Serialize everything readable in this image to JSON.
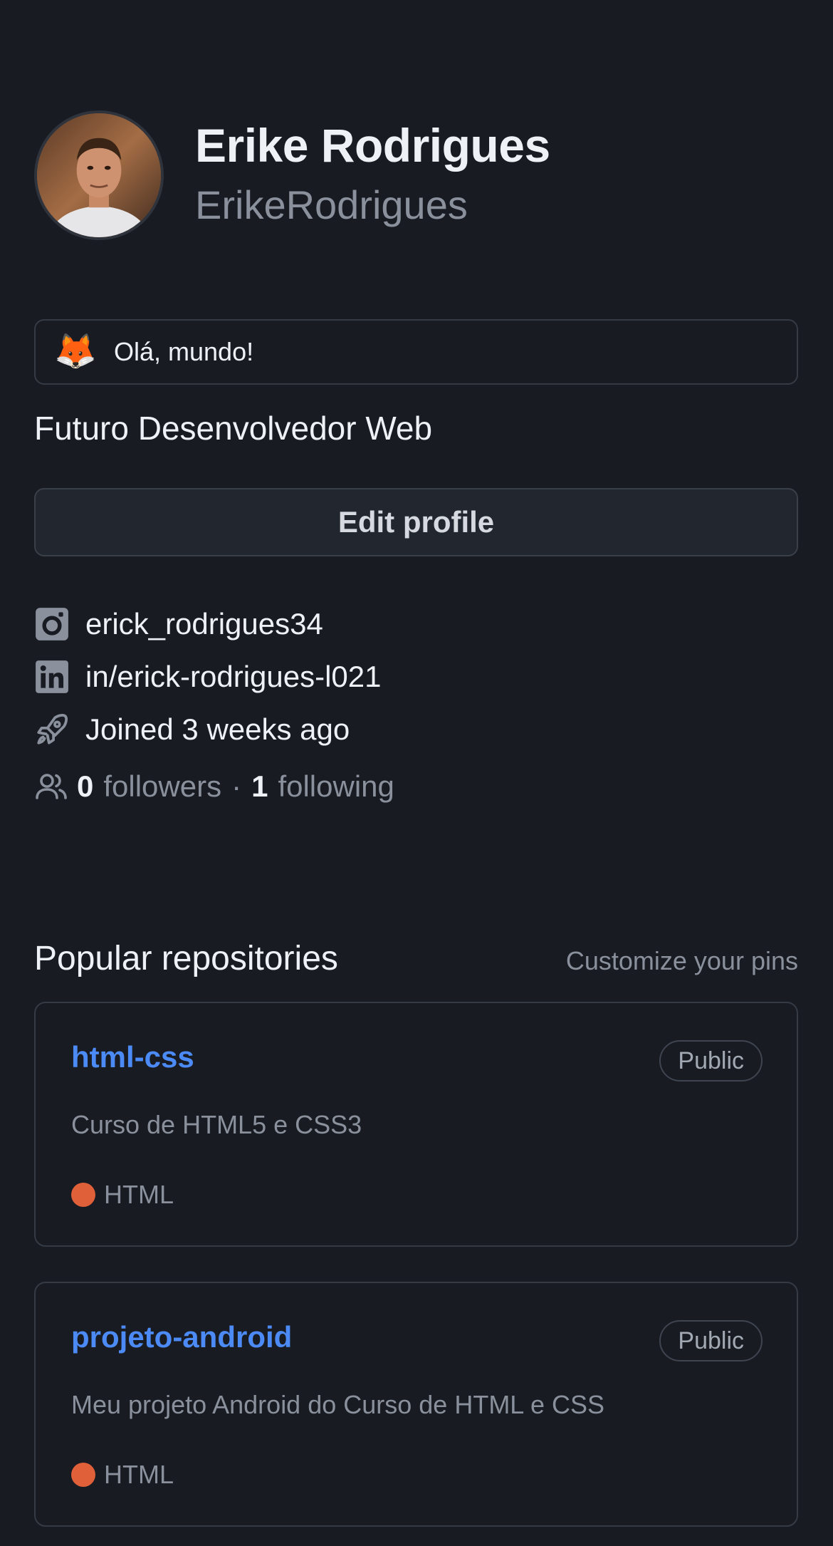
{
  "profile": {
    "name": "Erike Rodrigues",
    "login": "ErikeRodrigues",
    "status_emoji": "🦊",
    "status_text": "Olá, mundo!",
    "bio": "Futuro Desenvolvedor Web",
    "edit_label": "Edit profile"
  },
  "details": {
    "instagram": "erick_rodrigues34",
    "linkedin": "in/erick-rodrigues-l021",
    "joined": "Joined 3 weeks ago"
  },
  "follow": {
    "followers_count": "0",
    "followers_label": "followers",
    "separator": "·",
    "following_count": "1",
    "following_label": "following"
  },
  "repos_section": {
    "title": "Popular repositories",
    "customize_label": "Customize your pins",
    "items": [
      {
        "name": "html-css",
        "visibility": "Public",
        "description": "Curso de HTML5 e CSS3",
        "language": "HTML",
        "language_color": "#e06039"
      },
      {
        "name": "projeto-android",
        "visibility": "Public",
        "description": "Meu projeto Android do Curso de HTML e CSS",
        "language": "HTML",
        "language_color": "#e06039"
      }
    ]
  },
  "icons": [
    "instagram-icon",
    "linkedin-icon",
    "rocket-icon",
    "people-icon",
    "fox-emoji"
  ],
  "colors": {
    "background": "#181b22",
    "link": "#4c8bf5",
    "muted": "#8a919c",
    "border": "#353b45"
  }
}
